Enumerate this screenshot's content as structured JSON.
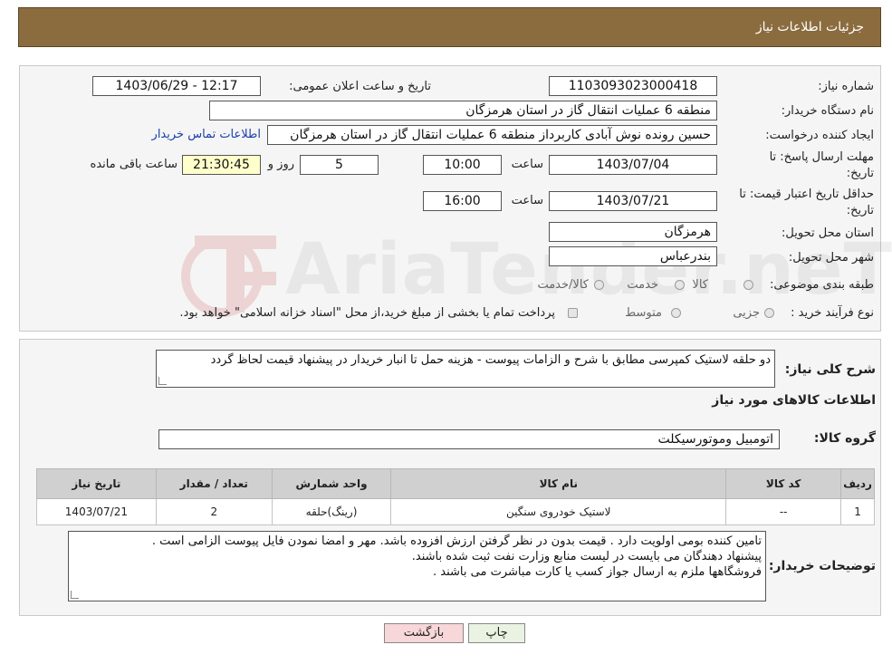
{
  "header": {
    "title": "جزئیات اطلاعات نیاز"
  },
  "form": {
    "need_number_label": "شماره نیاز:",
    "need_number": "1103093023000418",
    "announce_label": "تاریخ و ساعت اعلان عمومی:",
    "announce_value": "1403/06/29 - 12:17",
    "buyer_org_label": "نام دستگاه خریدار:",
    "buyer_org": "منطقه 6 عملیات انتقال گاز در استان هرمزگان",
    "creator_label": "ایجاد کننده درخواست:",
    "creator": "حسین رونده نوش آبادی کاربرداز منطقه 6 عملیات انتقال گاز در استان هرمزگان",
    "contact_link": "اطلاعات تماس خریدار",
    "deadline_label_line1": "مهلت ارسال پاسخ: تا",
    "deadline_label_line2": "تاریخ:",
    "deadline_date": "1403/07/04",
    "time_label": "ساعت",
    "deadline_time": "10:00",
    "remaining_days": "5",
    "days_label": "روز و",
    "remaining_time": "21:30:45",
    "remaining_label": "ساعت باقی مانده",
    "validity_label_line1": "حداقل تاریخ اعتبار قیمت: تا",
    "validity_label_line2": "تاریخ:",
    "validity_date": "1403/07/21",
    "validity_time_label": "ساعت",
    "validity_time": "16:00",
    "province_label": "استان محل تحویل:",
    "province": "هرمزگان",
    "city_label": "شهر محل تحویل:",
    "city": "بندرعباس",
    "category_label": "طبقه بندی موضوعی:",
    "category_options": [
      "کالا",
      "خدمت",
      "کالا/خدمت"
    ],
    "process_label": "نوع فرآیند خرید :",
    "process_options": [
      "جزیی",
      "متوسط"
    ],
    "process_note": "پرداخت تمام یا بخشی از مبلغ خرید،از محل \"اسناد خزانه اسلامی\" خواهد بود."
  },
  "description": {
    "label": "شرح کلی نیاز:",
    "text": "دو حلقه لاستیک کمپرسی مطابق با شرح و الزامات پیوست - هزینه حمل تا انبار خریدار در پیشنهاد قیمت لحاظ گردد"
  },
  "goods": {
    "section_title": "اطلاعات کالاهای مورد نیاز",
    "group_label": "گروه کالا:",
    "group_value": "اتومبیل وموتورسیکلت",
    "table": {
      "headers": [
        "ردیف",
        "کد کالا",
        "نام کالا",
        "واحد شمارش",
        "تعداد / مقدار",
        "تاریخ نیاز"
      ],
      "rows": [
        [
          "1",
          "--",
          "لاستیک خودروی سنگین",
          "(رینگ)حلقه",
          "2",
          "1403/07/21"
        ]
      ]
    }
  },
  "buyer_notes": {
    "label": "توضیحات خریدار:",
    "line1": "تامین کننده بومی اولویت دارد . قیمت بدون در نظر گرفتن  ارزش افزوده باشد. مهر و امضا نمودن فایل پیوست الزامی است .",
    "line2": "پیشنهاد دهندگان می بایست در لیست منابع وزارت نفت ثبت شده  باشند.",
    "line3": "فروشگاهها ملزم به ارسال جواز کسب یا کارت مباشرت می باشند ."
  },
  "buttons": {
    "print": "چاپ",
    "back": "بازگشت"
  },
  "watermark": {
    "text": "AriaTender.neT"
  },
  "colors": {
    "header_bg": "#8b6c3f",
    "link": "#1a3fa8",
    "back_button": "#f7d7d7",
    "print_button": "#eaf3e2",
    "remaining_bg": "#ffffcc"
  }
}
